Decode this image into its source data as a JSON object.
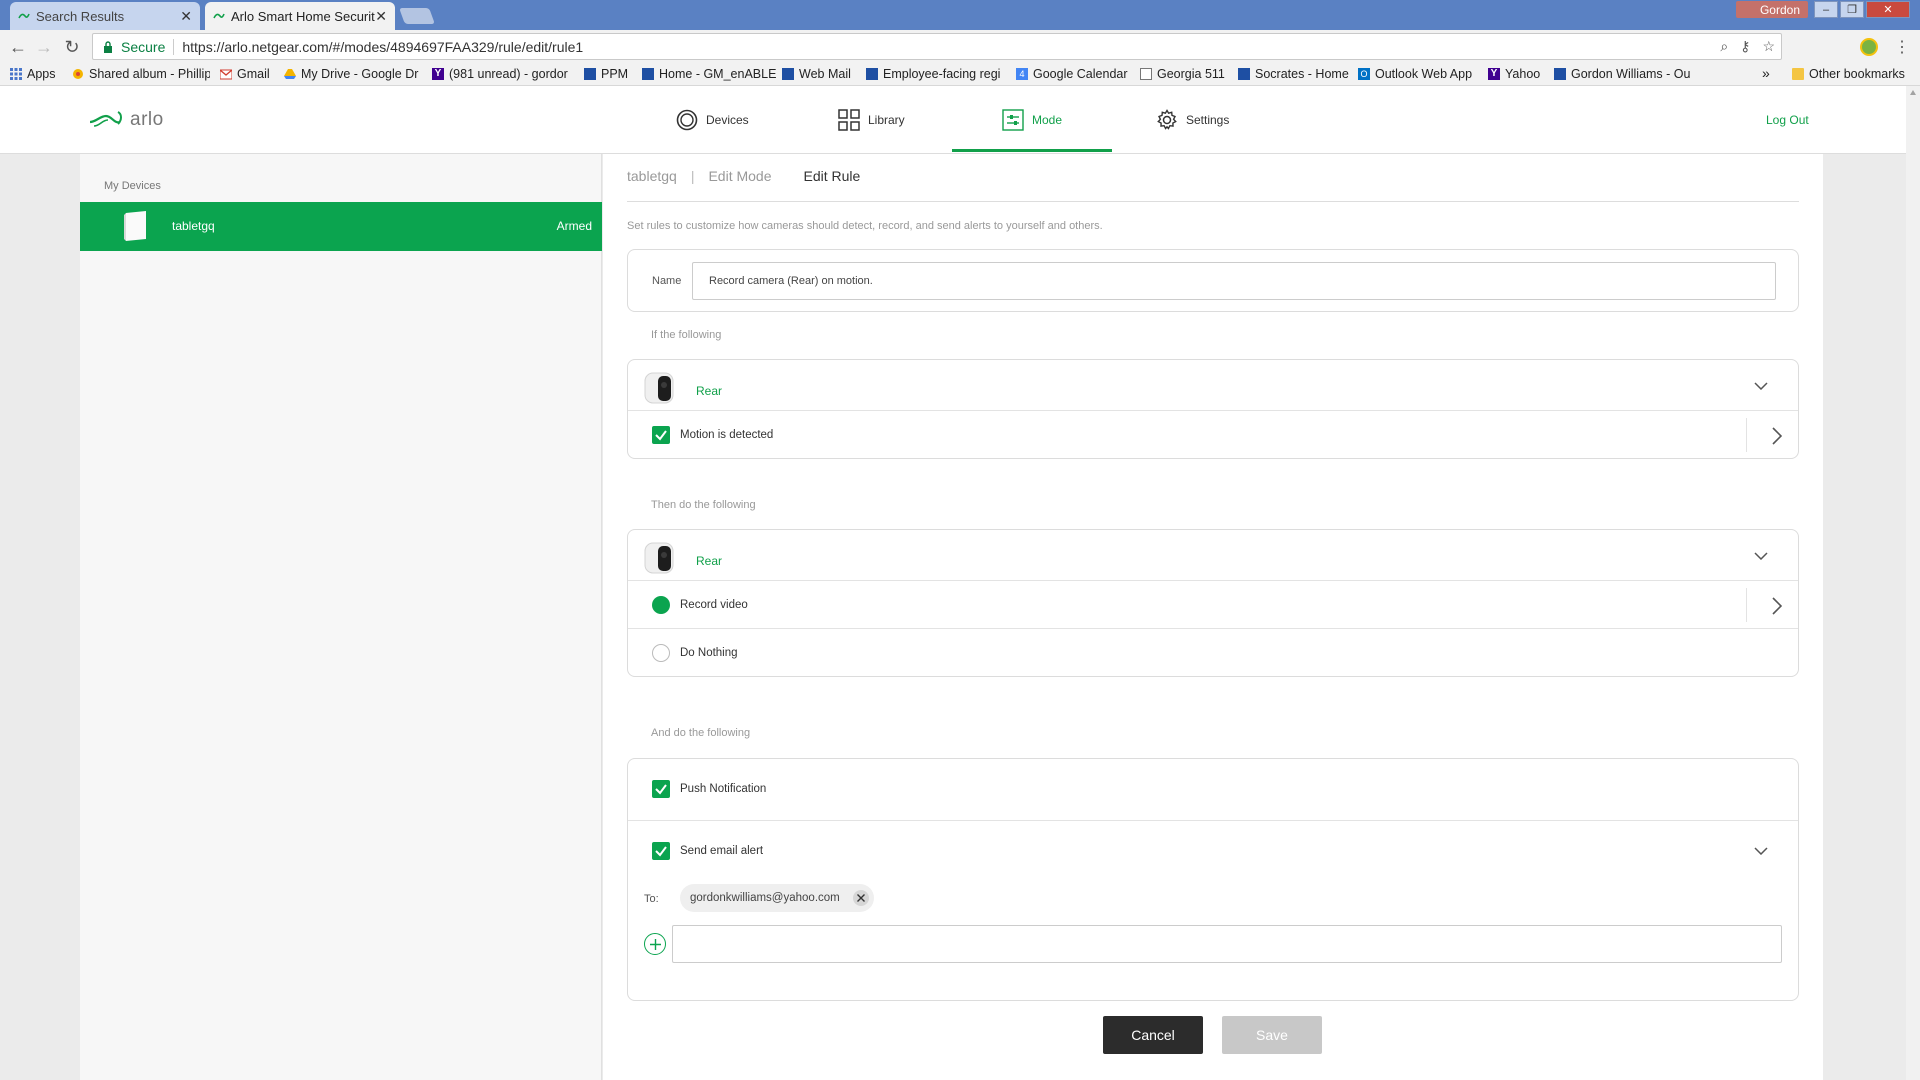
{
  "browser": {
    "tabs": [
      {
        "title": "Search Results",
        "active": false
      },
      {
        "title": "Arlo Smart Home Securit",
        "active": true
      }
    ],
    "profile_name": "Gordon",
    "secure_label": "Secure",
    "url": "https://arlo.netgear.com/#/modes/4894697FAA329/rule/edit/rule1",
    "bookmarks": [
      {
        "label": "Apps",
        "icon": "apps-grid-icon"
      },
      {
        "label": "Shared album - Phillip",
        "icon": "photos-icon"
      },
      {
        "label": "Gmail",
        "icon": "gmail-icon"
      },
      {
        "label": "My Drive - Google Dr",
        "icon": "drive-icon"
      },
      {
        "label": "(981 unread) - gordor",
        "icon": "yahoo-icon"
      },
      {
        "label": "PPM",
        "icon": "page-icon"
      },
      {
        "label": "Home - GM_enABLE",
        "icon": "page-icon"
      },
      {
        "label": "Web Mail",
        "icon": "page-icon"
      },
      {
        "label": "Employee-facing regi",
        "icon": "page-icon"
      },
      {
        "label": "Google Calendar",
        "icon": "calendar-icon"
      },
      {
        "label": "Georgia 511",
        "icon": "document-icon"
      },
      {
        "label": "Socrates - Home",
        "icon": "page-icon"
      },
      {
        "label": "Outlook Web App",
        "icon": "outlook-icon"
      },
      {
        "label": "Yahoo",
        "icon": "yahoo-icon"
      },
      {
        "label": "Gordon Williams - Ou",
        "icon": "page-icon"
      }
    ],
    "bookmarks_overflow": "»",
    "other_bookmarks": "Other bookmarks"
  },
  "header": {
    "logo_text": "arlo",
    "nav": [
      {
        "label": "Devices",
        "icon": "devices-icon",
        "active": false
      },
      {
        "label": "Library",
        "icon": "library-grid-icon",
        "active": false
      },
      {
        "label": "Mode",
        "icon": "mode-sliders-icon",
        "active": true
      },
      {
        "label": "Settings",
        "icon": "gear-icon",
        "active": false
      }
    ],
    "logout": "Log Out"
  },
  "sidebar": {
    "title": "My Devices",
    "devices": [
      {
        "name": "tabletgq",
        "status": "Armed",
        "icon": "base-station-icon"
      }
    ]
  },
  "main": {
    "breadcrumb": {
      "device": "tabletgq",
      "mode": "Edit Mode",
      "current": "Edit Rule"
    },
    "intro": "Set rules to customize how cameras should detect, record, and send alerts to yourself and others.",
    "name_label": "Name",
    "name_value": "Record camera (Rear) on motion.",
    "if_label": "If the following",
    "trigger": {
      "camera": "Rear",
      "condition": "Motion is detected",
      "condition_checked": true
    },
    "then_label": "Then do the following",
    "action": {
      "camera": "Rear",
      "options": [
        {
          "label": "Record video",
          "selected": true
        },
        {
          "label": "Do Nothing",
          "selected": false
        }
      ]
    },
    "and_label": "And do the following",
    "notifications": {
      "push_label": "Push Notification",
      "push_checked": true,
      "email_label": "Send email alert",
      "email_checked": true,
      "to_label": "To:",
      "recipients": [
        "gordonkwilliams@yahoo.com"
      ],
      "new_recipient_value": ""
    },
    "buttons": {
      "cancel": "Cancel",
      "save": "Save"
    }
  },
  "colors": {
    "accent": "#0ba44f",
    "arlo_green": "#11a04a",
    "cancel_bg": "#2c2c2c",
    "save_disabled": "#c8c8c8",
    "chrome_frame": "#5a81c3"
  }
}
